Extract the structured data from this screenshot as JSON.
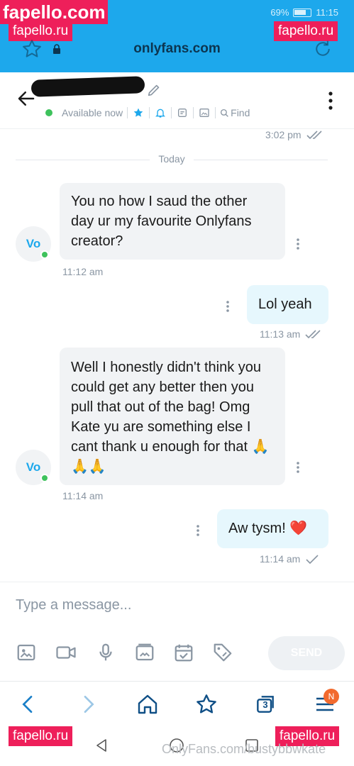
{
  "browser": {
    "battery": "69%",
    "clock": "11:15",
    "url": "onlyfans.com",
    "colors": {
      "bar": "#1da8ec",
      "url_text": "#0c3550"
    }
  },
  "watermarks": {
    "top_left_big": "fapello.com",
    "top_left": "fapello.ru",
    "top_right": "fapello.ru",
    "bottom_left": "fapello.ru",
    "bottom_right": "fapello.ru",
    "footer": "OnlyFans.com/bustybbwkate"
  },
  "chat_header": {
    "status": "Available now",
    "find_label": "Find",
    "icons": [
      "back-arrow-icon",
      "pencil-icon",
      "star-icon",
      "bell-icon",
      "note-icon",
      "image-icon",
      "search-icon",
      "more-vertical-icon"
    ]
  },
  "messages": {
    "prev_time": "3:02 pm",
    "day_divider": "Today",
    "avatar_initials": "Vo",
    "items": [
      {
        "dir": "in",
        "text": "You no how I saud the other day ur my favourite Onlyfans creator?",
        "time": "11:12 am"
      },
      {
        "dir": "out",
        "text": "Lol yeah",
        "time": "11:13 am"
      },
      {
        "dir": "in",
        "text": "Well I honestly didn't think you could get any better then you pull that out of the bag! Omg Kate yu are something else I cant thank u enough for that 🙏🙏🙏",
        "time": "11:14 am"
      },
      {
        "dir": "out",
        "text": "Aw tysm! ❤️",
        "time": "11:14 am"
      }
    ]
  },
  "compose": {
    "placeholder": "Type a message...",
    "send_label": "SEND",
    "tools": [
      "image-icon",
      "video-icon",
      "microphone-icon",
      "media-vault-icon",
      "schedule-icon",
      "price-tag-icon"
    ]
  },
  "bottom_nav": {
    "tabs_count": "3",
    "menu_badge": "N"
  }
}
